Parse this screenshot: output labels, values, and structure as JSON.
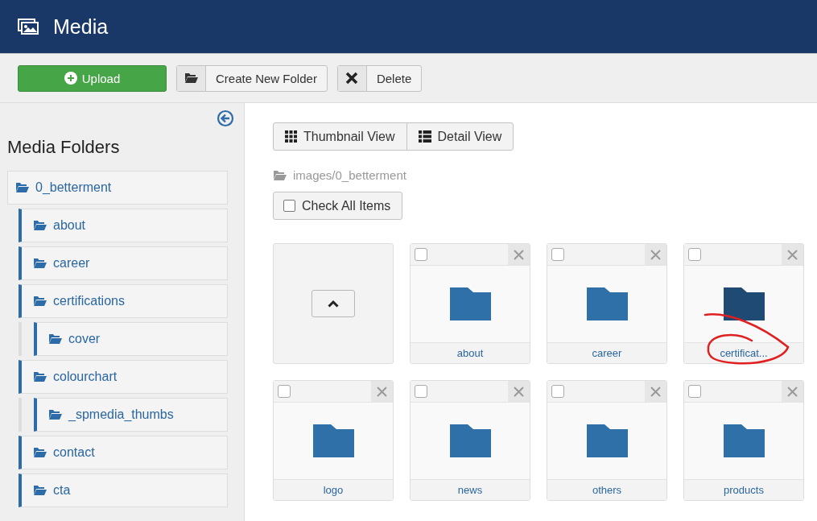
{
  "header": {
    "title": "Media"
  },
  "toolbar": {
    "buttons": [
      {
        "kind": "upload",
        "label": "Upload"
      },
      {
        "kind": "folder",
        "label": "Create New Folder"
      },
      {
        "kind": "delete",
        "label": "Delete"
      }
    ]
  },
  "sidebar": {
    "title": "Media Folders",
    "tree": [
      {
        "label": "0_betterment",
        "children": [
          {
            "label": "about"
          },
          {
            "label": "career"
          },
          {
            "label": "certifications",
            "children": [
              {
                "label": "cover"
              }
            ]
          },
          {
            "label": "colourchart",
            "children": [
              {
                "label": "_spmedia_thumbs"
              }
            ]
          },
          {
            "label": "contact"
          },
          {
            "label": "cta"
          }
        ]
      }
    ]
  },
  "views": [
    {
      "kind": "grid",
      "label": "Thumbnail View"
    },
    {
      "kind": "list",
      "label": "Detail View"
    }
  ],
  "path": "images/0_betterment",
  "check_all": {
    "label": "Check All Items",
    "checked": false
  },
  "items": [
    {
      "kind": "up"
    },
    {
      "kind": "folder",
      "label": "about",
      "checked": false,
      "highlighted": false,
      "annotated": false
    },
    {
      "kind": "folder",
      "label": "career",
      "checked": false,
      "highlighted": false,
      "annotated": false
    },
    {
      "kind": "folder",
      "label": "certificat...",
      "checked": false,
      "highlighted": true,
      "annotated": true
    },
    {
      "kind": "folder",
      "label": "logo",
      "checked": false,
      "highlighted": false,
      "annotated": false
    },
    {
      "kind": "folder",
      "label": "news",
      "checked": false,
      "highlighted": false,
      "annotated": false
    },
    {
      "kind": "folder",
      "label": "others",
      "checked": false,
      "highlighted": false,
      "annotated": false
    },
    {
      "kind": "folder",
      "label": "products",
      "checked": false,
      "highlighted": false,
      "annotated": false
    }
  ]
}
